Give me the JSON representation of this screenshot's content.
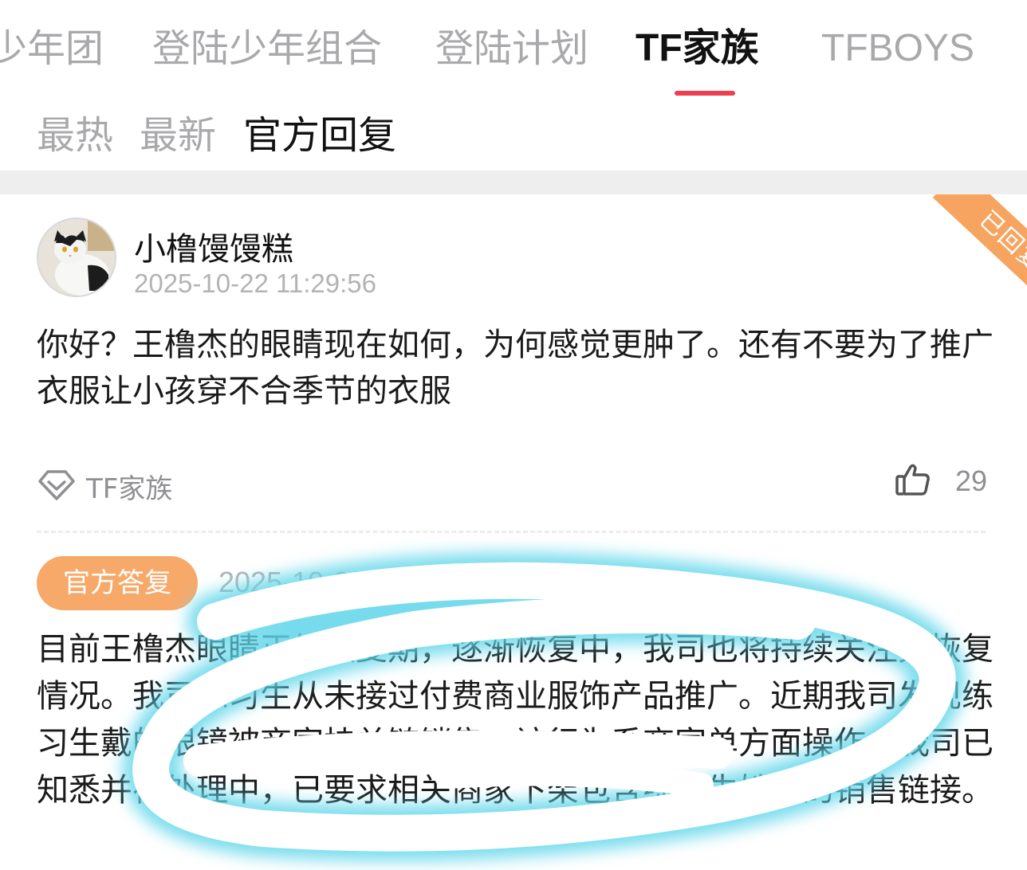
{
  "top_tabs": [
    {
      "label": "少年团"
    },
    {
      "label": "登陆少年组合"
    },
    {
      "label": "登陆计划"
    },
    {
      "label": "TF家族",
      "active": true
    },
    {
      "label": "TFBOYS"
    }
  ],
  "sort_tabs": [
    {
      "label": "最热"
    },
    {
      "label": "最新"
    },
    {
      "label": "官方回复",
      "active": true
    }
  ],
  "comment": {
    "username": "小橹馒馒糕",
    "timestamp": "2025-10-22 11:29:56",
    "status_ribbon": "已回复",
    "text": "你好？王橹杰的眼睛现在如何，为何感觉更肿了。还有不要为了推广衣服让小孩穿不合季节的衣服",
    "tag": {
      "icon": "diamond-icon",
      "label": "TF家族"
    },
    "likes": {
      "icon": "thumbs-up-icon",
      "count": "29"
    }
  },
  "reply": {
    "badge": "官方答复",
    "timestamp": "2025-10-23 0",
    "text": "目前王橹杰眼睛正处恢复期，逐渐恢复中，我司也将持续关注其恢复情况。我司练习生从未接过付费商业服饰产品推广。近期我司发现练习生戴的眼镜被商家挂单链销售，该行为系商家单方面操作，我司已知悉并在处理中，已要求相关商家下架包含练习生姓名的销售链接。"
  },
  "colors": {
    "accent_red": "#ee3e4f",
    "badge_orange": "#f7a96a",
    "ribbon_orange": "#f6a45f",
    "scribble_cyan": "#5fd6ea"
  }
}
